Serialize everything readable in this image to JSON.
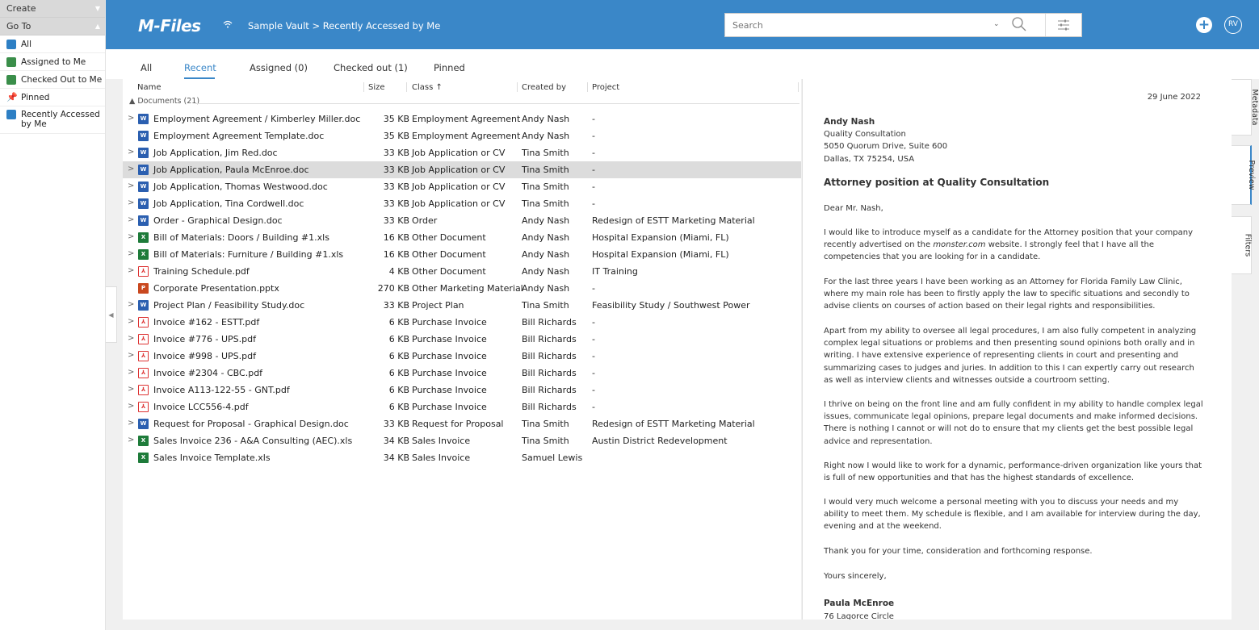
{
  "left_nav": {
    "create": "Create",
    "goto": "Go To",
    "items": [
      {
        "label": "All"
      },
      {
        "label": "Assigned to Me"
      },
      {
        "label": "Checked Out to Me"
      },
      {
        "label": "Pinned"
      },
      {
        "label": "Recently Accessed by Me"
      }
    ]
  },
  "header": {
    "logo": "M-Files",
    "breadcrumb": "Sample Vault > Recently Accessed by Me",
    "search_placeholder": "Search",
    "avatar": "RV",
    "accent": "#3a87c8"
  },
  "tabs": [
    "All",
    "Recent",
    "Assigned (0)",
    "Checked out (1)",
    "Pinned"
  ],
  "columns": {
    "name": "Name",
    "size": "Size",
    "class": "Class ↑",
    "created_by": "Created by",
    "project": "Project"
  },
  "group": "Documents (21)",
  "rows": [
    {
      "exp": ">",
      "icon": "doc",
      "name": "Employment Agreement / Kimberley Miller.doc",
      "size": "35 KB",
      "class": "Employment Agreement",
      "by": "Andy Nash",
      "project": "-"
    },
    {
      "exp": "",
      "icon": "doc",
      "name": "Employment Agreement Template.doc",
      "size": "35 KB",
      "class": "Employment Agreement",
      "by": "Andy Nash",
      "project": "-"
    },
    {
      "exp": ">",
      "icon": "doc",
      "name": "Job Application, Jim Red.doc",
      "size": "33 KB",
      "class": "Job Application or CV",
      "by": "Tina Smith",
      "project": "-"
    },
    {
      "exp": ">",
      "icon": "doc",
      "name": "Job Application, Paula McEnroe.doc",
      "size": "33 KB",
      "class": "Job Application or CV",
      "by": "Tina Smith",
      "project": "-"
    },
    {
      "exp": ">",
      "icon": "doc",
      "name": "Job Application, Thomas Westwood.doc",
      "size": "33 KB",
      "class": "Job Application or CV",
      "by": "Tina Smith",
      "project": "-"
    },
    {
      "exp": ">",
      "icon": "doc",
      "name": "Job Application, Tina Cordwell.doc",
      "size": "33 KB",
      "class": "Job Application or CV",
      "by": "Tina Smith",
      "project": "-"
    },
    {
      "exp": ">",
      "icon": "doc",
      "name": "Order - Graphical Design.doc",
      "size": "33 KB",
      "class": "Order",
      "by": "Andy Nash",
      "project": "Redesign of ESTT Marketing Material"
    },
    {
      "exp": ">",
      "icon": "xls",
      "name": "Bill of Materials: Doors / Building #1.xls",
      "size": "16 KB",
      "class": "Other Document",
      "by": "Andy Nash",
      "project": "Hospital Expansion (Miami, FL)"
    },
    {
      "exp": ">",
      "icon": "xls",
      "name": "Bill of Materials: Furniture / Building #1.xls",
      "size": "16 KB",
      "class": "Other Document",
      "by": "Andy Nash",
      "project": "Hospital Expansion (Miami, FL)"
    },
    {
      "exp": ">",
      "icon": "pdf",
      "name": "Training Schedule.pdf",
      "size": "4 KB",
      "class": "Other Document",
      "by": "Andy Nash",
      "project": "IT Training"
    },
    {
      "exp": "",
      "icon": "ppt",
      "name": "Corporate Presentation.pptx",
      "size": "270 KB",
      "class": "Other Marketing Material",
      "by": "Andy Nash",
      "project": "-"
    },
    {
      "exp": ">",
      "icon": "doc",
      "name": "Project Plan / Feasibility Study.doc",
      "size": "33 KB",
      "class": "Project Plan",
      "by": "Tina Smith",
      "project": "Feasibility Study / Southwest Power"
    },
    {
      "exp": ">",
      "icon": "pdf",
      "name": "Invoice #162 - ESTT.pdf",
      "size": "6 KB",
      "class": "Purchase Invoice",
      "by": "Bill Richards",
      "project": "-"
    },
    {
      "exp": ">",
      "icon": "pdf",
      "name": "Invoice #776 - UPS.pdf",
      "size": "6 KB",
      "class": "Purchase Invoice",
      "by": "Bill Richards",
      "project": "-"
    },
    {
      "exp": ">",
      "icon": "pdf",
      "name": "Invoice #998 - UPS.pdf",
      "size": "6 KB",
      "class": "Purchase Invoice",
      "by": "Bill Richards",
      "project": "-"
    },
    {
      "exp": ">",
      "icon": "pdf",
      "name": "Invoice #2304 - CBC.pdf",
      "size": "6 KB",
      "class": "Purchase Invoice",
      "by": "Bill Richards",
      "project": "-"
    },
    {
      "exp": ">",
      "icon": "pdf",
      "name": "Invoice A113-122-55 - GNT.pdf",
      "size": "6 KB",
      "class": "Purchase Invoice",
      "by": "Bill Richards",
      "project": "-"
    },
    {
      "exp": ">",
      "icon": "pdf",
      "name": "Invoice LCC556-4.pdf",
      "size": "6 KB",
      "class": "Purchase Invoice",
      "by": "Bill Richards",
      "project": "-"
    },
    {
      "exp": ">",
      "icon": "doc",
      "name": "Request for Proposal - Graphical Design.doc",
      "size": "33 KB",
      "class": "Request for Proposal",
      "by": "Tina Smith",
      "project": "Redesign of ESTT Marketing Material"
    },
    {
      "exp": ">",
      "icon": "xls",
      "name": "Sales Invoice 236 - A&A Consulting (AEC).xls",
      "size": "34 KB",
      "class": "Sales Invoice",
      "by": "Tina Smith",
      "project": "Austin District Redevelopment"
    },
    {
      "exp": "",
      "icon": "xls",
      "name": "Sales Invoice Template.xls",
      "size": "34 KB",
      "class": "Sales Invoice",
      "by": "Samuel Lewis",
      "project": ""
    }
  ],
  "preview": {
    "date": "29 June 2022",
    "sender_name": "Andy Nash",
    "address": [
      "Quality Consultation",
      "5050 Quorum Drive, Suite 600",
      "Dallas, TX 75254, USA"
    ],
    "title": "Attorney position at Quality Consultation",
    "salutation": "Dear Mr. Nash,",
    "p1_a": "I would like to introduce myself as a candidate for the Attorney position that your company recently advertised on the ",
    "p1_em": "monster.com",
    "p1_b": " website. I strongly feel that I have all the competencies that you are looking for in a candidate.",
    "p2": "For the last three years I have been working as an Attorney for Florida Family Law Clinic, where my main role has been to firstly apply the law to specific situations and secondly to advise clients on courses of action based on their legal rights and responsibilities.",
    "p3": "Apart from my ability to oversee all legal procedures, I am also fully competent in analyzing complex legal situations or problems and then presenting sound opinions both orally and in writing. I have extensive experience of representing clients in court and presenting and summarizing cases to judges and juries. In addition to this I can expertly carry out research as well as interview clients and witnesses outside a courtroom setting.",
    "p4": "I thrive on being on the front line and am fully confident in my ability to handle complex legal issues, communicate legal opinions, prepare legal documents and make informed decisions. There is nothing I cannot or will not do to ensure that my clients get the best possible legal advice and representation.",
    "p5": "Right now I would like to work for a dynamic, performance-driven organization like yours that is full of new opportunities and that has the highest standards of excellence.",
    "p6": "I would very much welcome a personal meeting with you to discuss your needs and my ability to meet them. My schedule is flexible, and I am available for interview during the day, evening and at the weekend.",
    "p7": "Thank you for your time, consideration and forthcoming response.",
    "closing": "Yours sincerely,",
    "signature": "Paula McEnroe",
    "sig_address": "76 Lagorce Circle"
  },
  "side_tabs": [
    "Metadata",
    "Preview",
    "Filters"
  ]
}
